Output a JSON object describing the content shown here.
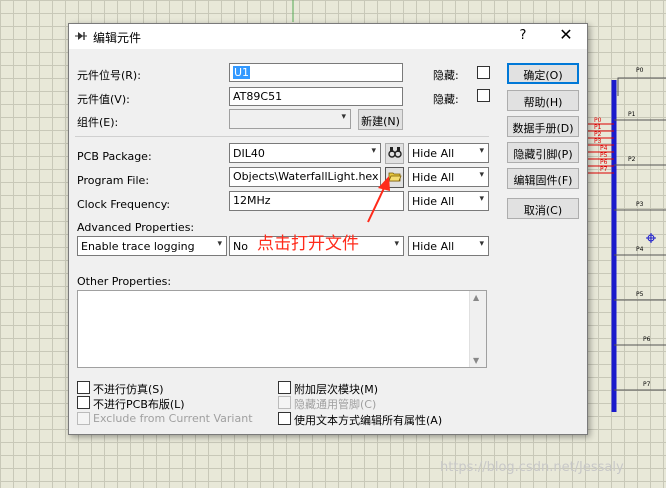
{
  "dialog": {
    "title": "编辑元件",
    "help": "?",
    "close": "✕"
  },
  "fields": {
    "ref_label": "元件位号(R):",
    "ref_value": "U1",
    "ref_hidden_label": "隐藏:",
    "value_label": "元件值(V):",
    "value_value": "AT89C51",
    "value_hidden_label": "隐藏:",
    "group_label": "组件(E):",
    "new_button": "新建(N)",
    "pcb_label": "PCB Package:",
    "pcb_value": "DIL40",
    "pcb_hide": "Hide All",
    "program_label": "Program File:",
    "program_value": "Objects\\WaterfallLight.hex",
    "program_hide": "Hide All",
    "clock_label": "Clock Frequency:",
    "clock_value": "12MHz",
    "clock_hide": "Hide All",
    "advanced_label": "Advanced Properties:",
    "advanced_option": "Enable trace logging",
    "advanced_value": "No",
    "advanced_hide": "Hide All",
    "other_label": "Other Properties:"
  },
  "checkboxes": [
    {
      "label": "不进行仿真(S)",
      "disabled": false
    },
    {
      "label": "不进行PCB布版(L)",
      "disabled": false
    },
    {
      "label": "Exclude from Current Variant",
      "disabled": true
    },
    {
      "label": "附加层次模块(M)",
      "disabled": false
    },
    {
      "label": "隐藏通用管脚(C)",
      "disabled": true
    },
    {
      "label": "使用文本方式编辑所有属性(A)",
      "disabled": false
    }
  ],
  "buttons": {
    "ok": "确定(O)",
    "help": "帮助(H)",
    "datasheet": "数据手册(D)",
    "hidden_pins": "隐藏引脚(P)",
    "edit_firmware": "编辑固件(F)",
    "cancel": "取消(C)"
  },
  "annotation": "点击打开文件",
  "watermark": "https://blog.csdn.net/Jessaly",
  "schematic": {
    "pins": [
      "P0",
      "P1",
      "P2",
      "P3",
      "P4",
      "P5",
      "P6",
      "P7"
    ],
    "red_pins": [
      "P0",
      "P1",
      "P2",
      "P3",
      "P4",
      "P5",
      "P6",
      "P7"
    ]
  },
  "colors": {
    "accent": "#0078d7",
    "annotation": "#ff2a1a",
    "bus": "#1a1acc",
    "grid": "#e8e8d8"
  }
}
